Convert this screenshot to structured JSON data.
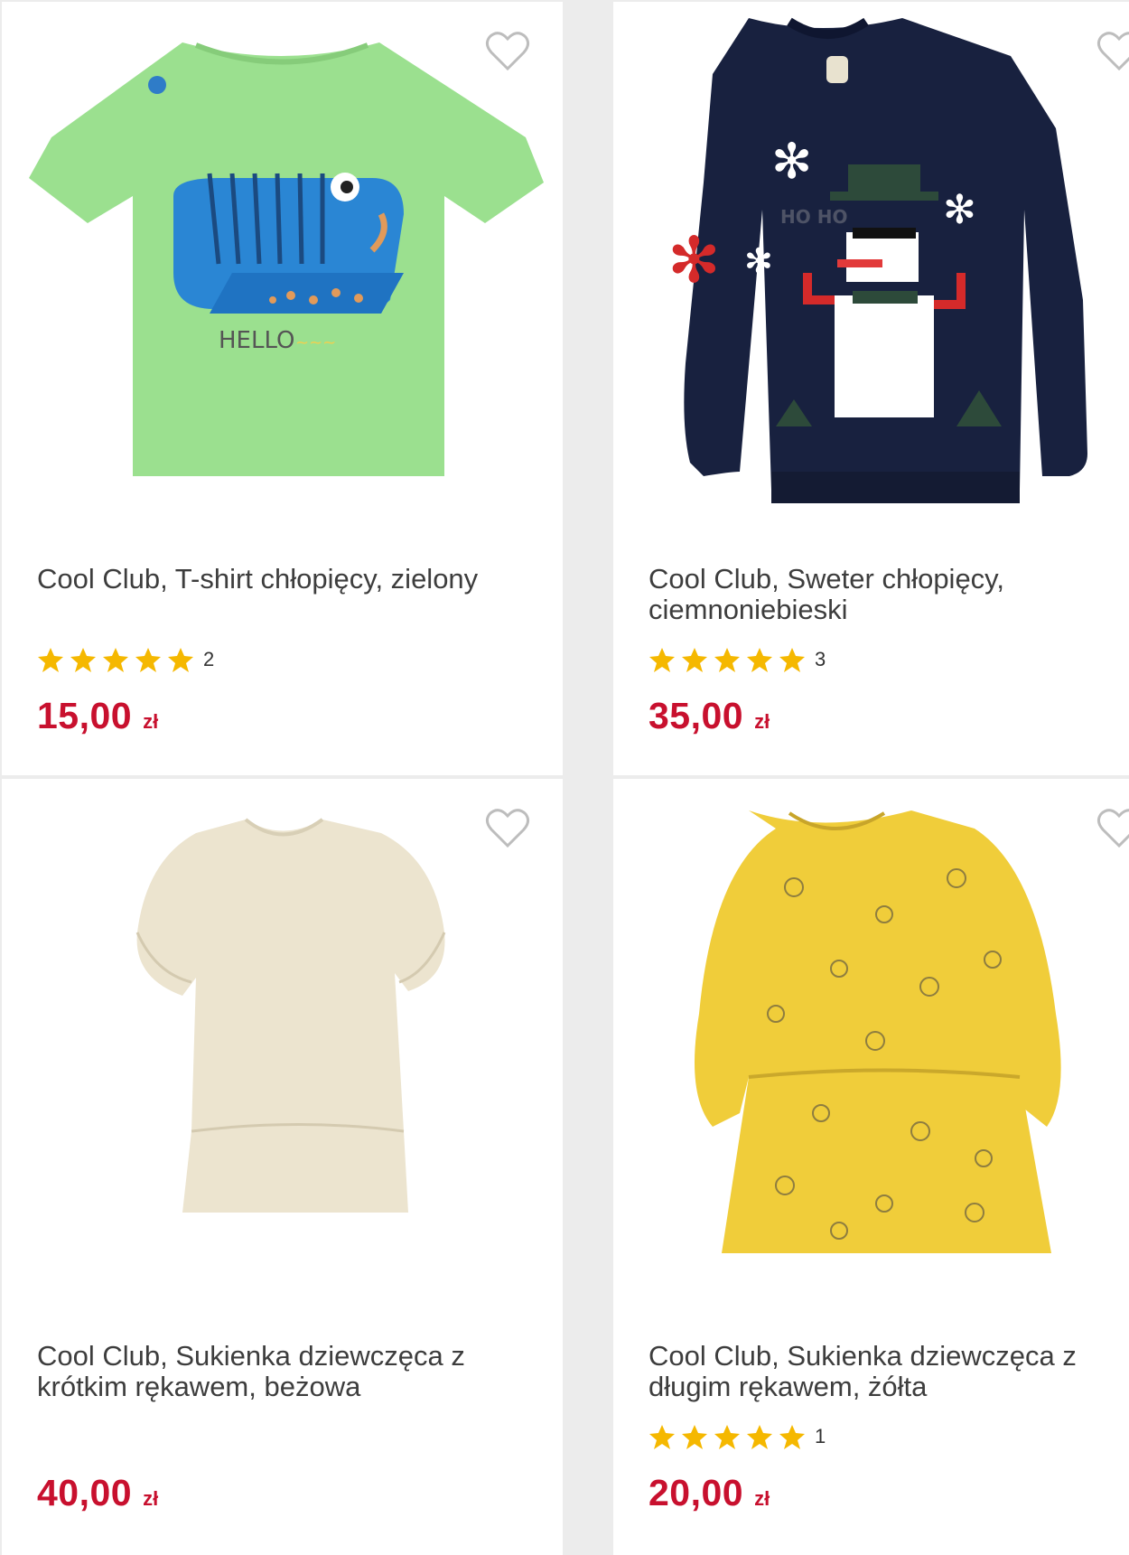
{
  "colors": {
    "price": "#c8102e",
    "star": "#f5b800",
    "heart": "#bdbdbd"
  },
  "products": [
    {
      "title": "Cool Club, T-shirt chłopięcy, zielony",
      "rating": 5,
      "reviews": "2",
      "price": "15,00",
      "currency": "zł",
      "image": "green-tshirt-image",
      "print_text": "HELLO"
    },
    {
      "title": "Cool Club, Sweter chłopięcy, ciemnoniebieski",
      "rating": 5,
      "reviews": "3",
      "price": "35,00",
      "currency": "zł",
      "image": "navy-snowman-sweater-image",
      "print_text": "HO HO"
    },
    {
      "title": "Cool Club, Sukienka dziewczęca z krótkim rękawem, beżowa",
      "rating": null,
      "reviews": "",
      "price": "40,00",
      "currency": "zł",
      "image": "beige-dress-image"
    },
    {
      "title": "Cool Club, Sukienka dziewczęca z długim rękawem, żółta",
      "rating": 5,
      "reviews": "1",
      "price": "20,00",
      "currency": "zł",
      "image": "yellow-dress-image"
    }
  ]
}
